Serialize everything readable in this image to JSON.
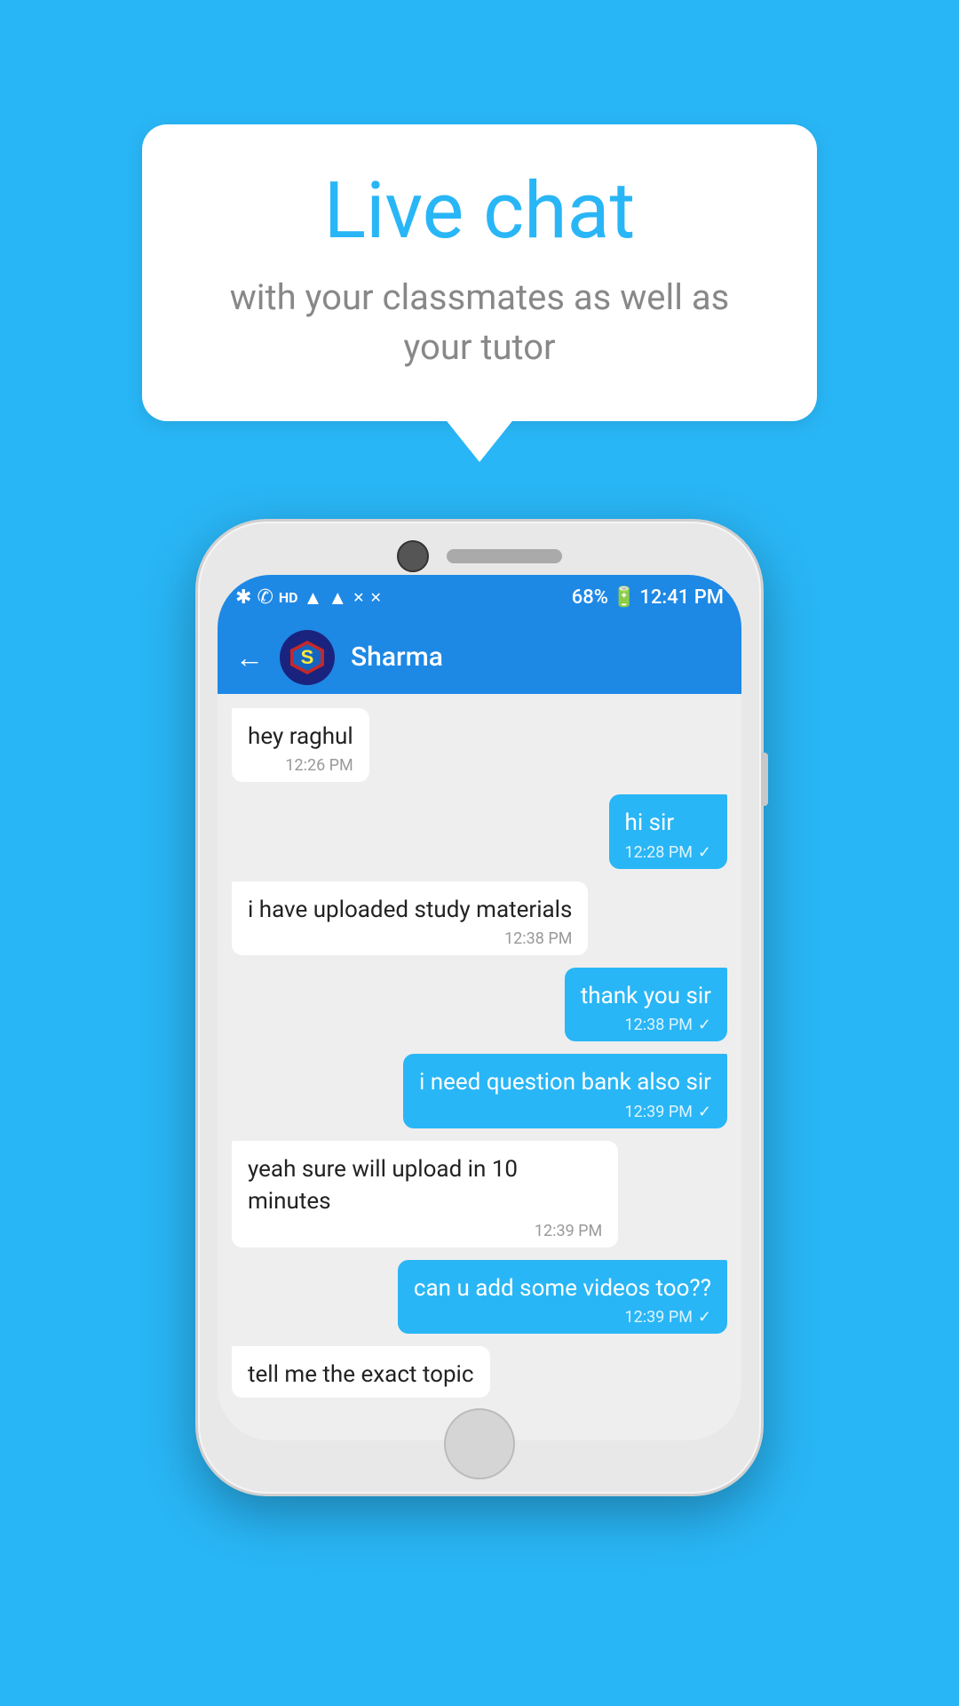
{
  "background_color": "#29b6f6",
  "speech_bubble": {
    "title": "Live chat",
    "subtitle": "with your classmates as well as your tutor"
  },
  "phone": {
    "status_bar": {
      "time": "12:41 PM",
      "battery": "68%",
      "icons": "bluetooth, vibrate, hd, wifi, signal, x, x"
    },
    "app_bar": {
      "contact_name": "Sharma",
      "back_label": "←"
    },
    "messages": [
      {
        "id": 1,
        "type": "received",
        "text": "hey raghul",
        "time": "12:26 PM",
        "read": false
      },
      {
        "id": 2,
        "type": "sent",
        "text": "hi sir",
        "time": "12:28 PM",
        "read": true
      },
      {
        "id": 3,
        "type": "received",
        "text": "i have uploaded study materials",
        "time": "12:38 PM",
        "read": false
      },
      {
        "id": 4,
        "type": "sent",
        "text": "thank you sir",
        "time": "12:38 PM",
        "read": true
      },
      {
        "id": 5,
        "type": "sent",
        "text": "i need question bank also sir",
        "time": "12:39 PM",
        "read": true
      },
      {
        "id": 6,
        "type": "received",
        "text": "yeah sure will upload in 10 minutes",
        "time": "12:39 PM",
        "read": false
      },
      {
        "id": 7,
        "type": "sent",
        "text": "can u add some videos too??",
        "time": "12:39 PM",
        "read": true
      },
      {
        "id": 8,
        "type": "received",
        "text": "tell me the exact topic",
        "time": "",
        "read": false,
        "partial": true
      }
    ]
  }
}
